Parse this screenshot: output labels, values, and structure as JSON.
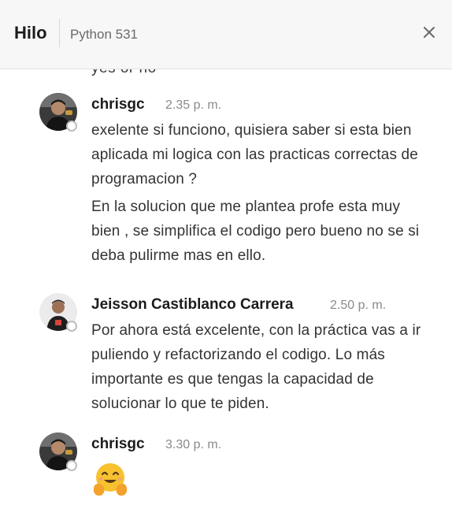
{
  "header": {
    "title": "Hilo",
    "channel": "Python 531",
    "close_icon": "close-icon"
  },
  "thread": {
    "truncated_text": "yes  or no",
    "messages": [
      {
        "author": "chrisgc",
        "time": "2.35 p. m.",
        "paragraphs": [
          "exelente si funciono, quisiera saber si esta bien aplicada mi logica con las practicas correctas de programacion ?",
          "En la solucion que me plantea profe esta muy bien , se simplifica el codigo pero bueno no se si deba pulirme mas en ello."
        ]
      },
      {
        "author": "Jeisson Castiblanco Carrera",
        "time": "2.50 p. m.",
        "paragraphs": [
          "Por ahora está excelente, con la práctica vas a ir puliendo y refactorizando el codigo. Lo más importante es que tengas la capacidad de solucionar lo que te piden."
        ]
      },
      {
        "author": "chrisgc",
        "time": "3.30 p. m.",
        "emoji": "hugging-face-emoji"
      }
    ]
  },
  "colors": {
    "header_bg": "#f6f7f6",
    "status_ring": "#bdbdbd",
    "emoji_yellow": "#f7c12f"
  }
}
